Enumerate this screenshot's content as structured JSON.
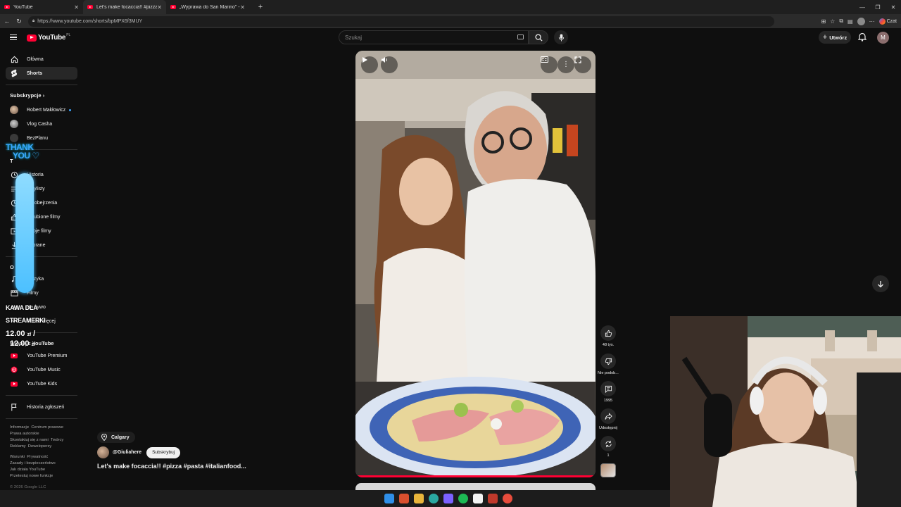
{
  "browser": {
    "tabs": [
      {
        "title": "YouTube",
        "active": false
      },
      {
        "title": "Let's make focaccia!! #pizza #pasta",
        "active": true
      },
      {
        "title": "„Wyprawa do San Marino” - ROBE",
        "active": false
      }
    ],
    "url": "https://www.youtube.com/shorts/bpMPX6f3MUY",
    "copilot_label": "Czat"
  },
  "header": {
    "logo_text": "YouTube",
    "country_code": "PL",
    "search_placeholder": "Szukaj",
    "create_label": "Utwórz",
    "avatar_letter": "M"
  },
  "sidebar": {
    "main": [
      {
        "label": "Główna",
        "icon": "home-icon"
      },
      {
        "label": "Shorts",
        "icon": "shorts-icon",
        "active": true
      }
    ],
    "subscriptions_title": "Subskrypcje",
    "subscriptions": [
      {
        "label": "Robert Makłowicz",
        "new": true
      },
      {
        "label": "Vlog Casha"
      },
      {
        "label": "BezPlanu"
      }
    ],
    "you_section_letter": "T",
    "you_items": [
      {
        "label": "Historia",
        "icon": "history-icon"
      },
      {
        "label": "Playlisty",
        "icon": "playlist-icon"
      },
      {
        "label": "Do obejrzenia",
        "icon": "watch-later-icon"
      },
      {
        "label": "Polubione filmy",
        "icon": "like-icon"
      },
      {
        "label": "Twoje filmy",
        "icon": "video-icon"
      },
      {
        "label": "Pobrane",
        "icon": "download-icon"
      }
    ],
    "explore_letter": "O",
    "explore_items": [
      {
        "label": "Muzyka",
        "icon": "music-icon"
      },
      {
        "label": "Filmy",
        "icon": "film-icon"
      },
      {
        "label": "Na żywo",
        "icon": "live-icon"
      },
      {
        "label": "Pokaż więcej",
        "icon": "chevron-down-icon"
      }
    ],
    "more_title": "Więcej z YouTube",
    "more_items": [
      {
        "label": "YouTube Premium"
      },
      {
        "label": "YouTube Music"
      },
      {
        "label": "YouTube Kids"
      }
    ],
    "report_history": "Historia zgłoszeń",
    "footer1": [
      "Informacje",
      "Centrum prasowe",
      "Prawa autorskie",
      "Skontaktuj się z nami",
      "Twórcy",
      "Reklamy",
      "Deweloperzy"
    ],
    "footer2": [
      "Warunki",
      "Prywatność",
      "Zasady i bezpieczeństwo",
      "Jak działa YouTube",
      "Przetestuj nowe funkcje"
    ],
    "copyright": "© 2026 Google LLC"
  },
  "overlay": {
    "thanks_line1": "THANK",
    "thanks_line2": "YOU",
    "kawa_line1": "KAWA DLA",
    "kawa_line2": "STREAMERKI",
    "amount_current": "12.00",
    "amount_goal": "12.00",
    "currency": "zł",
    "progress_fraction": 1.0
  },
  "short": {
    "location": "Calgary",
    "channel": "@Giuliahere",
    "subscribe_label": "Subskrybuj",
    "title": "Let's make focaccia!! #pizza #pasta #italianfood...",
    "likes": "48 tys.",
    "dislike_label": "Nie podob...",
    "comments": "1995",
    "share_label": "Udostępnij",
    "remix_count": "1"
  }
}
